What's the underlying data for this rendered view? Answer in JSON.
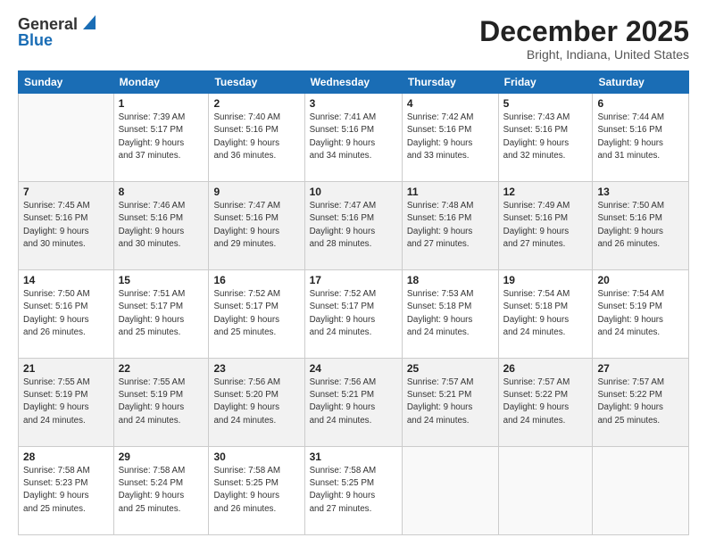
{
  "header": {
    "logo_general": "General",
    "logo_blue": "Blue",
    "title": "December 2025",
    "location": "Bright, Indiana, United States"
  },
  "days_of_week": [
    "Sunday",
    "Monday",
    "Tuesday",
    "Wednesday",
    "Thursday",
    "Friday",
    "Saturday"
  ],
  "weeks": [
    [
      {
        "day": "",
        "detail": ""
      },
      {
        "day": "1",
        "detail": "Sunrise: 7:39 AM\nSunset: 5:17 PM\nDaylight: 9 hours\nand 37 minutes."
      },
      {
        "day": "2",
        "detail": "Sunrise: 7:40 AM\nSunset: 5:16 PM\nDaylight: 9 hours\nand 36 minutes."
      },
      {
        "day": "3",
        "detail": "Sunrise: 7:41 AM\nSunset: 5:16 PM\nDaylight: 9 hours\nand 34 minutes."
      },
      {
        "day": "4",
        "detail": "Sunrise: 7:42 AM\nSunset: 5:16 PM\nDaylight: 9 hours\nand 33 minutes."
      },
      {
        "day": "5",
        "detail": "Sunrise: 7:43 AM\nSunset: 5:16 PM\nDaylight: 9 hours\nand 32 minutes."
      },
      {
        "day": "6",
        "detail": "Sunrise: 7:44 AM\nSunset: 5:16 PM\nDaylight: 9 hours\nand 31 minutes."
      }
    ],
    [
      {
        "day": "7",
        "detail": "Sunrise: 7:45 AM\nSunset: 5:16 PM\nDaylight: 9 hours\nand 30 minutes."
      },
      {
        "day": "8",
        "detail": "Sunrise: 7:46 AM\nSunset: 5:16 PM\nDaylight: 9 hours\nand 30 minutes."
      },
      {
        "day": "9",
        "detail": "Sunrise: 7:47 AM\nSunset: 5:16 PM\nDaylight: 9 hours\nand 29 minutes."
      },
      {
        "day": "10",
        "detail": "Sunrise: 7:47 AM\nSunset: 5:16 PM\nDaylight: 9 hours\nand 28 minutes."
      },
      {
        "day": "11",
        "detail": "Sunrise: 7:48 AM\nSunset: 5:16 PM\nDaylight: 9 hours\nand 27 minutes."
      },
      {
        "day": "12",
        "detail": "Sunrise: 7:49 AM\nSunset: 5:16 PM\nDaylight: 9 hours\nand 27 minutes."
      },
      {
        "day": "13",
        "detail": "Sunrise: 7:50 AM\nSunset: 5:16 PM\nDaylight: 9 hours\nand 26 minutes."
      }
    ],
    [
      {
        "day": "14",
        "detail": "Sunrise: 7:50 AM\nSunset: 5:16 PM\nDaylight: 9 hours\nand 26 minutes."
      },
      {
        "day": "15",
        "detail": "Sunrise: 7:51 AM\nSunset: 5:17 PM\nDaylight: 9 hours\nand 25 minutes."
      },
      {
        "day": "16",
        "detail": "Sunrise: 7:52 AM\nSunset: 5:17 PM\nDaylight: 9 hours\nand 25 minutes."
      },
      {
        "day": "17",
        "detail": "Sunrise: 7:52 AM\nSunset: 5:17 PM\nDaylight: 9 hours\nand 24 minutes."
      },
      {
        "day": "18",
        "detail": "Sunrise: 7:53 AM\nSunset: 5:18 PM\nDaylight: 9 hours\nand 24 minutes."
      },
      {
        "day": "19",
        "detail": "Sunrise: 7:54 AM\nSunset: 5:18 PM\nDaylight: 9 hours\nand 24 minutes."
      },
      {
        "day": "20",
        "detail": "Sunrise: 7:54 AM\nSunset: 5:19 PM\nDaylight: 9 hours\nand 24 minutes."
      }
    ],
    [
      {
        "day": "21",
        "detail": "Sunrise: 7:55 AM\nSunset: 5:19 PM\nDaylight: 9 hours\nand 24 minutes."
      },
      {
        "day": "22",
        "detail": "Sunrise: 7:55 AM\nSunset: 5:19 PM\nDaylight: 9 hours\nand 24 minutes."
      },
      {
        "day": "23",
        "detail": "Sunrise: 7:56 AM\nSunset: 5:20 PM\nDaylight: 9 hours\nand 24 minutes."
      },
      {
        "day": "24",
        "detail": "Sunrise: 7:56 AM\nSunset: 5:21 PM\nDaylight: 9 hours\nand 24 minutes."
      },
      {
        "day": "25",
        "detail": "Sunrise: 7:57 AM\nSunset: 5:21 PM\nDaylight: 9 hours\nand 24 minutes."
      },
      {
        "day": "26",
        "detail": "Sunrise: 7:57 AM\nSunset: 5:22 PM\nDaylight: 9 hours\nand 24 minutes."
      },
      {
        "day": "27",
        "detail": "Sunrise: 7:57 AM\nSunset: 5:22 PM\nDaylight: 9 hours\nand 25 minutes."
      }
    ],
    [
      {
        "day": "28",
        "detail": "Sunrise: 7:58 AM\nSunset: 5:23 PM\nDaylight: 9 hours\nand 25 minutes."
      },
      {
        "day": "29",
        "detail": "Sunrise: 7:58 AM\nSunset: 5:24 PM\nDaylight: 9 hours\nand 25 minutes."
      },
      {
        "day": "30",
        "detail": "Sunrise: 7:58 AM\nSunset: 5:25 PM\nDaylight: 9 hours\nand 26 minutes."
      },
      {
        "day": "31",
        "detail": "Sunrise: 7:58 AM\nSunset: 5:25 PM\nDaylight: 9 hours\nand 27 minutes."
      },
      {
        "day": "",
        "detail": ""
      },
      {
        "day": "",
        "detail": ""
      },
      {
        "day": "",
        "detail": ""
      }
    ]
  ]
}
